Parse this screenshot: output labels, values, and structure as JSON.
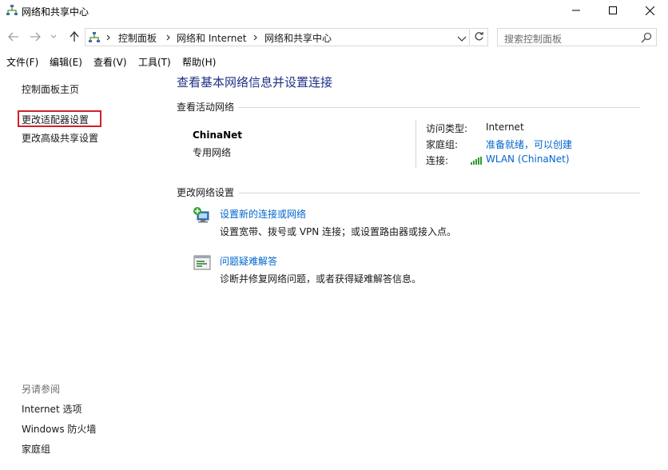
{
  "window": {
    "title": "网络和共享中心"
  },
  "breadcrumb": [
    "控制面板",
    "网络和 Internet",
    "网络和共享中心"
  ],
  "search": {
    "placeholder": "搜索控制面板"
  },
  "menu": [
    "文件(F)",
    "编辑(E)",
    "查看(V)",
    "工具(T)",
    "帮助(H)"
  ],
  "sidebar": {
    "home": "控制面板主页",
    "links": [
      "更改适配器设置",
      "更改高级共享设置"
    ],
    "see_also_title": "另请参阅",
    "see_also": [
      "Internet 选项",
      "Windows 防火墙",
      "家庭组"
    ]
  },
  "main": {
    "title": "查看基本网络信息并设置连接",
    "active_networks_label": "查看活动网络",
    "network": {
      "name": "ChinaNet",
      "type": "专用网络",
      "access_type_label": "访问类型:",
      "access_type_value": "Internet",
      "homegroup_label": "家庭组:",
      "homegroup_value": "准备就绪，可以创建",
      "connection_label": "连接:",
      "connection_value": "WLAN (ChinaNet)"
    },
    "change_settings_label": "更改网络设置",
    "tasks": [
      {
        "icon": "new-connection-icon",
        "link": "设置新的连接或网络",
        "desc": "设置宽带、拨号或 VPN 连接；或设置路由器或接入点。"
      },
      {
        "icon": "troubleshoot-icon",
        "link": "问题疑难解答",
        "desc": "诊断并修复网络问题，或者获得疑难解答信息。"
      }
    ]
  },
  "colors": {
    "title_blue": "#1e3287",
    "link_blue": "#0066cc",
    "highlight_red": "#d0202a"
  }
}
